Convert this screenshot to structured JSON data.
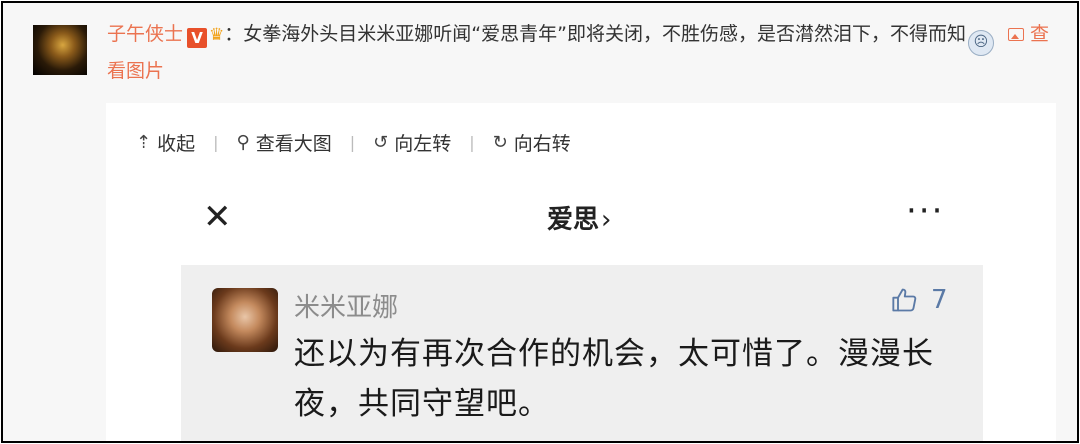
{
  "post": {
    "author": "子午侠士",
    "verified_badge": "V",
    "separator": "：",
    "text_before_emoji": "女拳海外头目米米亚娜听闻“爱思青年”即将关闭，不胜伤感，是否潸然泪下，不得而知",
    "view_image_label": "查看图片"
  },
  "toolbar": {
    "collapse_label": "收起",
    "view_large_label": "查看大图",
    "rotate_left_label": "向左转",
    "rotate_right_label": "向右转"
  },
  "screenshot": {
    "header_title": "爱思",
    "comment": {
      "username": "米米亚娜",
      "like_count": "7",
      "text": "还以为有再次合作的机会，太可惜了。漫漫长夜，共同守望吧。"
    }
  },
  "colors": {
    "author": "#eb7350",
    "badge": "#e8502a",
    "link": "#eb7350",
    "like": "#5b7aa6"
  },
  "icons": [
    "verified-badge-icon",
    "crown-icon",
    "emoji-icon",
    "picture-icon",
    "collapse-icon",
    "magnifier-icon",
    "rotate-left-icon",
    "rotate-right-icon",
    "close-icon",
    "chevron-right-icon",
    "more-icon",
    "thumbs-up-icon"
  ]
}
